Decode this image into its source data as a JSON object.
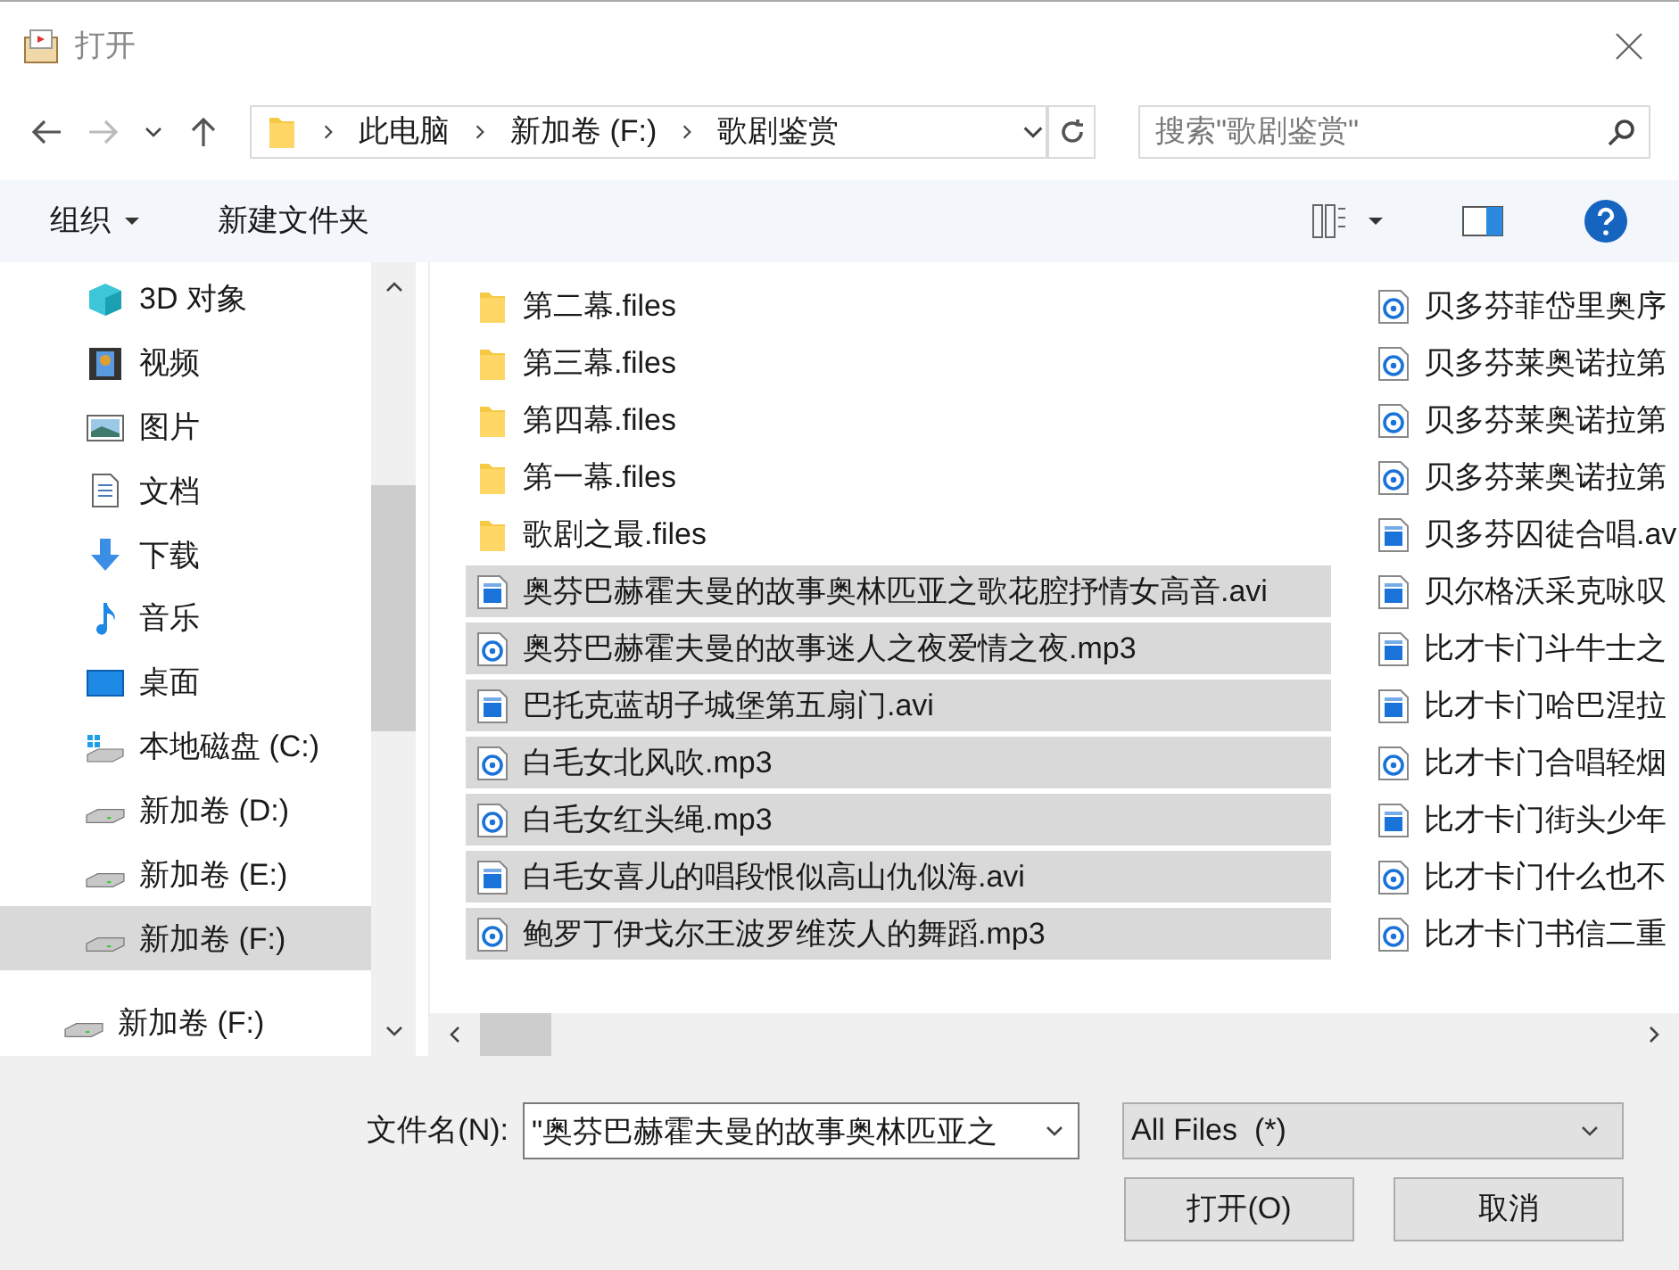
{
  "window": {
    "title": "打开"
  },
  "address": {
    "crumbs": [
      "此电脑",
      "新加卷 (F:)",
      "歌剧鉴赏"
    ]
  },
  "search": {
    "placeholder": "搜索\"歌剧鉴赏\""
  },
  "toolbar": {
    "organize": "组织",
    "new_folder": "新建文件夹"
  },
  "nav": [
    {
      "label": "3D 对象",
      "kind": "cube",
      "selected": false
    },
    {
      "label": "视频",
      "kind": "video",
      "selected": false
    },
    {
      "label": "图片",
      "kind": "picture",
      "selected": false
    },
    {
      "label": "文档",
      "kind": "document",
      "selected": false
    },
    {
      "label": "下载",
      "kind": "download",
      "selected": false
    },
    {
      "label": "音乐",
      "kind": "music",
      "selected": false
    },
    {
      "label": "桌面",
      "kind": "desktop",
      "selected": false
    },
    {
      "label": "本地磁盘 (C:)",
      "kind": "system-drive",
      "selected": false
    },
    {
      "label": "新加卷 (D:)",
      "kind": "drive",
      "selected": false
    },
    {
      "label": "新加卷 (E:)",
      "kind": "drive",
      "selected": false
    },
    {
      "label": "新加卷 (F:)",
      "kind": "drive",
      "selected": true
    }
  ],
  "nav_bottom": {
    "label": "新加卷 (F:)",
    "kind": "drive"
  },
  "files": [
    [
      {
        "name": "第二幕.files",
        "kind": "folder",
        "selected": false
      },
      {
        "name": "第三幕.files",
        "kind": "folder",
        "selected": false
      },
      {
        "name": "第四幕.files",
        "kind": "folder",
        "selected": false
      },
      {
        "name": "第一幕.files",
        "kind": "folder",
        "selected": false
      },
      {
        "name": "歌剧之最.files",
        "kind": "folder",
        "selected": false
      },
      {
        "name": "奥芬巴赫霍夫曼的故事奥林匹亚之歌花腔抒情女高音.avi",
        "kind": "video",
        "selected": true
      },
      {
        "name": "奥芬巴赫霍夫曼的故事迷人之夜爱情之夜.mp3",
        "kind": "audio",
        "selected": true
      },
      {
        "name": "巴托克蓝胡子城堡第五扇门.avi",
        "kind": "video",
        "selected": true
      },
      {
        "name": "白毛女北风吹.mp3",
        "kind": "audio",
        "selected": true
      },
      {
        "name": "白毛女红头绳.mp3",
        "kind": "audio",
        "selected": true
      },
      {
        "name": "白毛女喜儿的唱段恨似高山仇似海.avi",
        "kind": "video",
        "selected": true
      },
      {
        "name": "鲍罗丁伊戈尔王波罗维茨人的舞蹈.mp3",
        "kind": "audio",
        "selected": true
      }
    ],
    [
      {
        "name": "贝多芬菲岱里奥序",
        "kind": "audio",
        "selected": false
      },
      {
        "name": "贝多芬莱奥诺拉第",
        "kind": "audio",
        "selected": false
      },
      {
        "name": "贝多芬莱奥诺拉第",
        "kind": "audio",
        "selected": false
      },
      {
        "name": "贝多芬莱奥诺拉第",
        "kind": "audio",
        "selected": false
      },
      {
        "name": "贝多芬囚徒合唱.av",
        "kind": "video",
        "selected": false
      },
      {
        "name": "贝尔格沃采克咏叹",
        "kind": "video",
        "selected": false
      },
      {
        "name": "比才卡门斗牛士之",
        "kind": "video",
        "selected": false
      },
      {
        "name": "比才卡门哈巴涅拉",
        "kind": "video",
        "selected": false
      },
      {
        "name": "比才卡门合唱轻烟",
        "kind": "audio",
        "selected": false
      },
      {
        "name": "比才卡门街头少年",
        "kind": "video",
        "selected": false
      },
      {
        "name": "比才卡门什么也不",
        "kind": "audio",
        "selected": false
      },
      {
        "name": "比才卡门书信二重",
        "kind": "audio",
        "selected": false
      }
    ]
  ],
  "filename": {
    "label": "文件名(N):",
    "value": "\"奥芬巴赫霍夫曼的故事奥林匹亚之"
  },
  "filter": {
    "value": "All Files  (*)"
  },
  "buttons": [
    "打开(O)",
    "取消"
  ]
}
